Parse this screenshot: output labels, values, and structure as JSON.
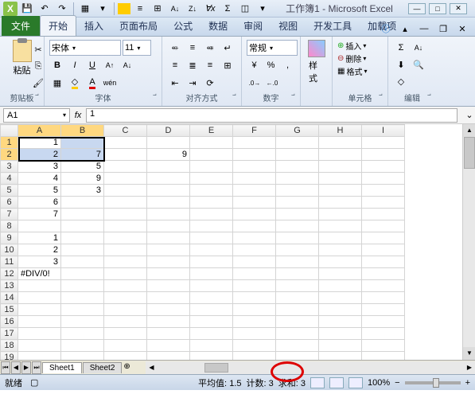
{
  "qat": {
    "office": "X"
  },
  "title": "工作簿1 - Microsoft Excel",
  "tabs": {
    "file": "文件",
    "items": [
      "开始",
      "插入",
      "页面布局",
      "公式",
      "数据",
      "审阅",
      "视图",
      "开发工具",
      "加载项"
    ],
    "active": 0
  },
  "ribbon": {
    "clipboard": {
      "paste": "粘贴",
      "label": "剪贴板"
    },
    "font": {
      "name": "宋体",
      "size": "11",
      "label": "字体"
    },
    "align": {
      "label": "对齐方式"
    },
    "number": {
      "format": "常规",
      "label": "数字"
    },
    "styles": {
      "btn": "样式"
    },
    "cells": {
      "insert": "插入",
      "delete": "删除",
      "format": "格式",
      "label": "单元格"
    },
    "editing": {
      "label": "编辑"
    }
  },
  "namebox": "A1",
  "formula": "1",
  "cols": [
    "A",
    "B",
    "C",
    "D",
    "E",
    "F",
    "G",
    "H",
    "I"
  ],
  "rows": 19,
  "cells": {
    "A1": "1",
    "A2": "2",
    "A3": "3",
    "A4": "4",
    "A5": "5",
    "A6": "6",
    "A7": "7",
    "B2": "7",
    "B3": "5",
    "B4": "9",
    "B5": "3",
    "D2": "9",
    "A9": "1",
    "A10": "2",
    "A11": "3",
    "A12": "#DIV/0!"
  },
  "selection": {
    "range": "A1:B2",
    "active": "A1"
  },
  "sheets": {
    "items": [
      "Sheet1",
      "Sheet2"
    ],
    "active": 0
  },
  "status": {
    "ready": "就绪",
    "avg_label": "平均值:",
    "avg": "1.5",
    "count_label": "计数:",
    "count": "3",
    "sum_label": "求和:",
    "sum": "3",
    "zoom": "100%"
  }
}
